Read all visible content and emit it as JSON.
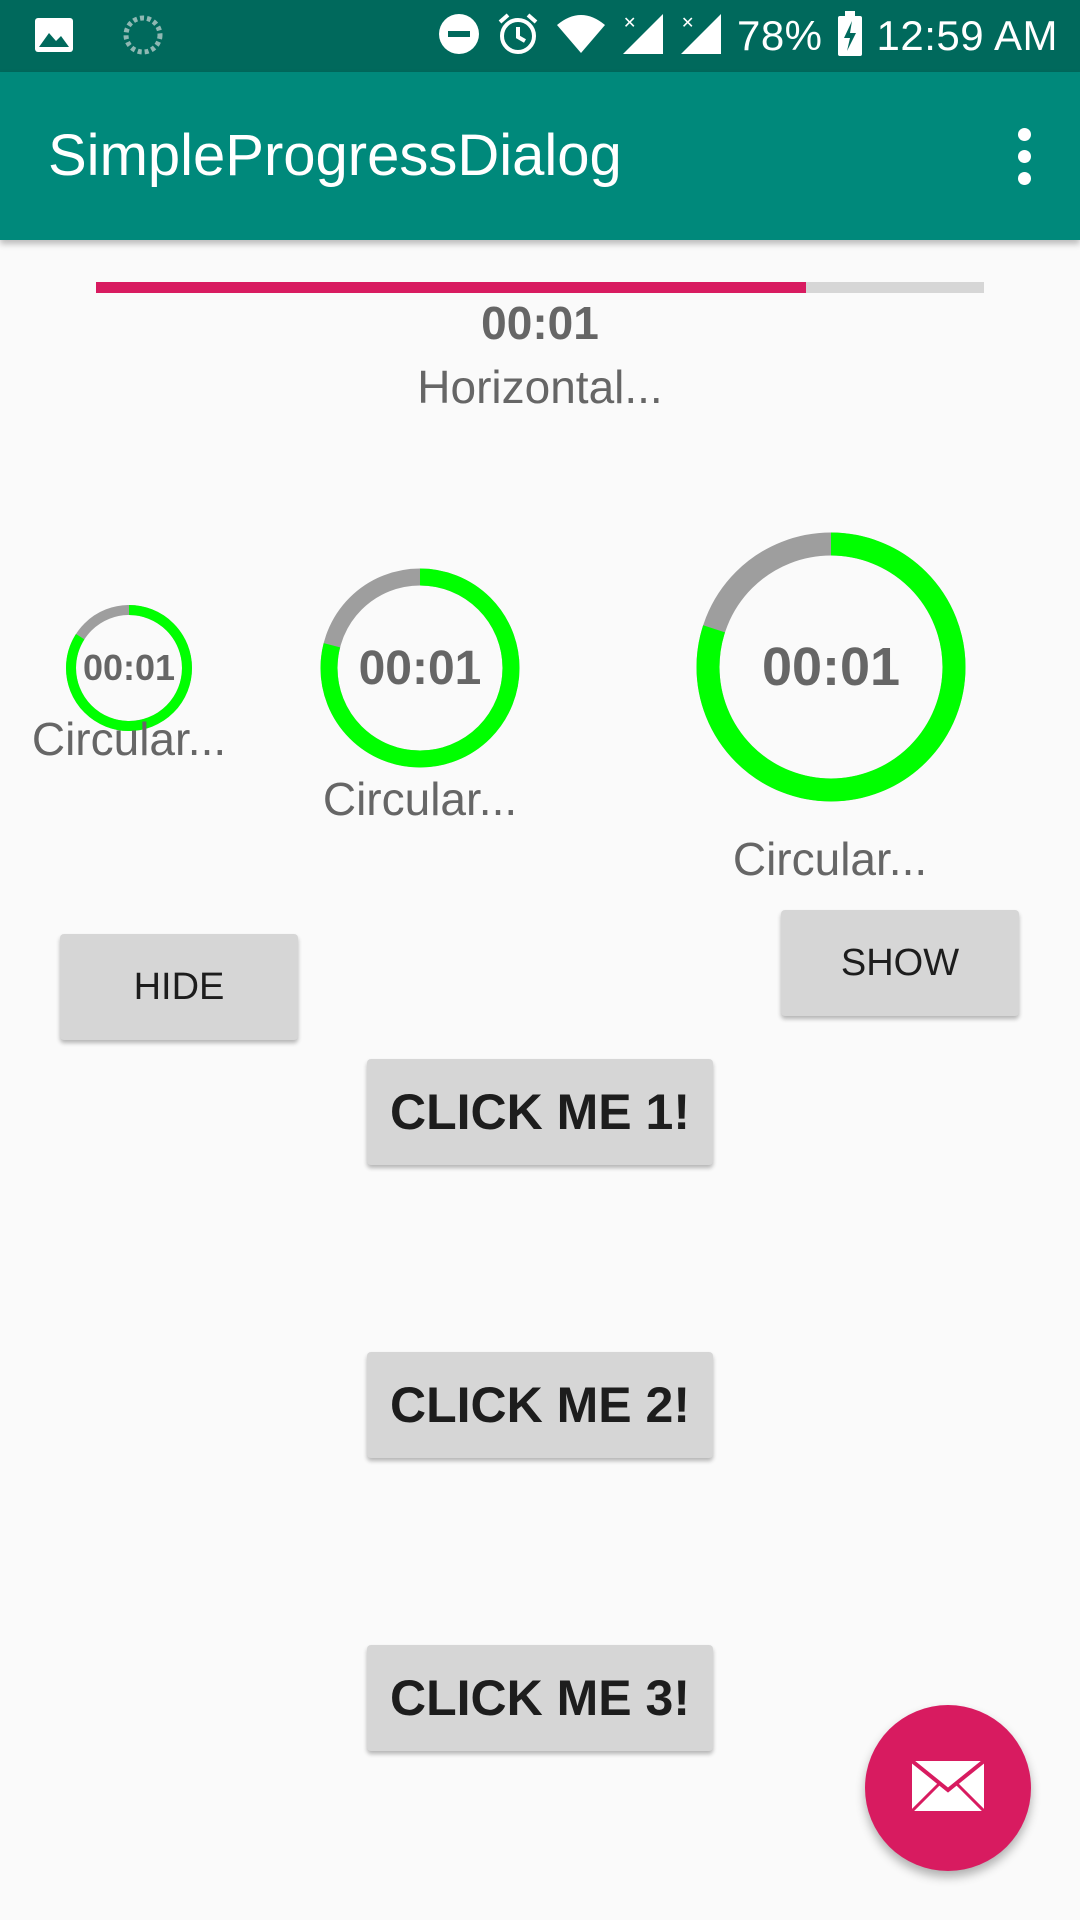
{
  "status_bar": {
    "battery": "78%",
    "time": "12:59 AM",
    "icons": [
      "image-icon",
      "loading-icon",
      "dnd-icon",
      "alarm-icon",
      "wifi-icon",
      "signal-icon",
      "signal-icon",
      "battery-charging-icon"
    ]
  },
  "app_bar": {
    "title": "SimpleProgressDialog",
    "menu_icon": "overflow-menu-icon"
  },
  "horizontal": {
    "progress": 0.8,
    "time": "00:01",
    "label": "Horizontal..."
  },
  "circulars": [
    {
      "time": "00:01",
      "label": "Circular...",
      "progress": 0.84
    },
    {
      "time": "00:01",
      "label": "Circular...",
      "progress": 0.79
    },
    {
      "time": "00:01",
      "label": "Circular...",
      "progress": 0.8
    }
  ],
  "colors": {
    "app_bar": "#00897b",
    "status_bar": "#00695c",
    "accent": "#d81b60",
    "ring_progress": "#00ff00",
    "ring_track": "#9e9e9e"
  },
  "buttons": {
    "hide": "HIDE",
    "show": "SHOW",
    "click1": "CLICK ME 1!",
    "click2": "CLICK ME 2!",
    "click3": "CLICK ME 3!"
  },
  "fab": {
    "icon": "mail-icon"
  }
}
